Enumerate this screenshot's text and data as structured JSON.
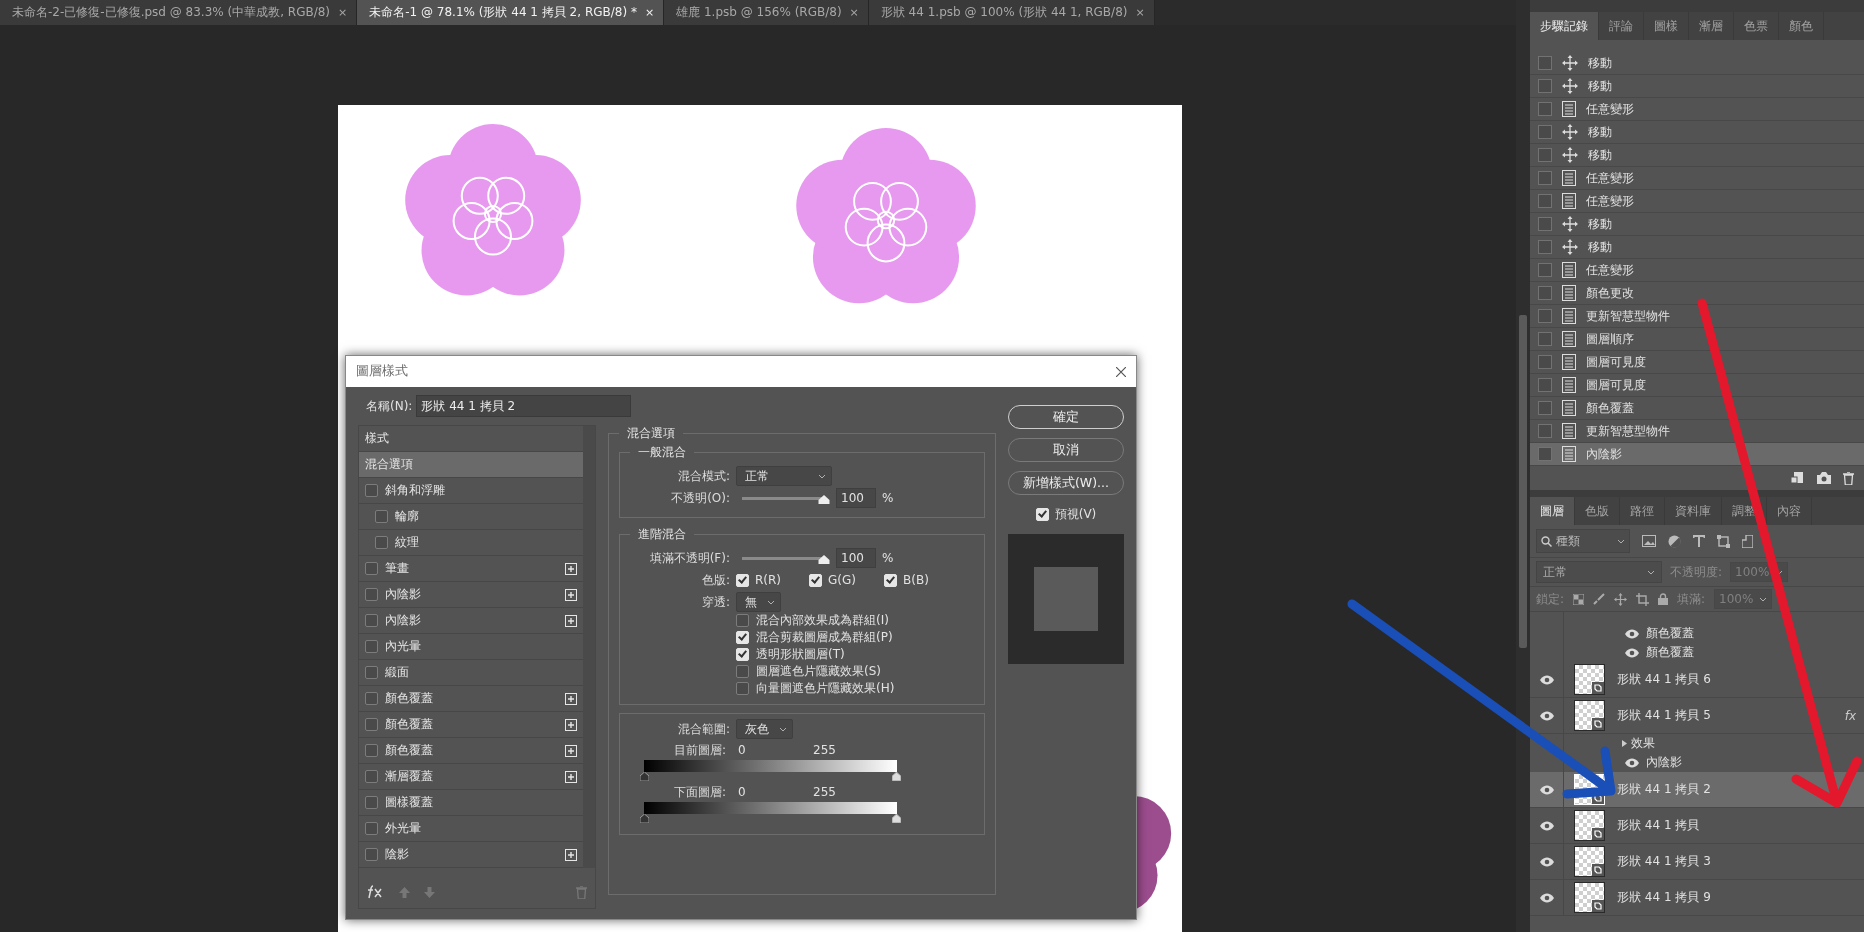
{
  "document_tabs": [
    {
      "label": "未命名-2-已修復-已修復.psd @ 83.3% (中華成教, RGB/8)",
      "close": "×",
      "selected": false
    },
    {
      "label": "未命名-1 @ 78.1% (形狀 44 1 拷貝 2, RGB/8) *",
      "close": "×",
      "selected": true
    },
    {
      "label": "雄鹿 1.psb @ 156% (RGB/8)",
      "close": "×",
      "selected": false
    },
    {
      "label": "形狀 44 1.psb @ 100% (形狀 44 1, RGB/8)",
      "close": "×",
      "selected": false
    }
  ],
  "dialog": {
    "title": "圖層樣式",
    "name_label": "名稱(N):",
    "name_value": "形狀 44 1 拷貝 2",
    "styles": [
      {
        "kind": "heading",
        "label": "樣式",
        "selected": false
      },
      {
        "kind": "option",
        "label": "混合選項",
        "selected": true
      },
      {
        "kind": "effect",
        "label": "斜角和浮雕",
        "checked": false,
        "addable": false,
        "selected": false,
        "children": [
          {
            "kind": "effect",
            "label": "輪廓",
            "checked": false,
            "addable": false,
            "selected": false
          },
          {
            "kind": "effect",
            "label": "紋理",
            "checked": false,
            "addable": false,
            "selected": false
          }
        ]
      },
      {
        "kind": "effect",
        "label": "筆畫",
        "checked": false,
        "addable": true,
        "selected": false
      },
      {
        "kind": "effect",
        "label": "內陰影",
        "checked": false,
        "addable": true,
        "selected": false
      },
      {
        "kind": "effect",
        "label": "內陰影",
        "checked": false,
        "addable": true,
        "selected": false
      },
      {
        "kind": "effect",
        "label": "內光暈",
        "checked": false,
        "addable": false,
        "selected": false
      },
      {
        "kind": "effect",
        "label": "緞面",
        "checked": false,
        "addable": false,
        "selected": false
      },
      {
        "kind": "effect",
        "label": "顏色覆蓋",
        "checked": false,
        "addable": true,
        "selected": false
      },
      {
        "kind": "effect",
        "label": "顏色覆蓋",
        "checked": false,
        "addable": true,
        "selected": false
      },
      {
        "kind": "effect",
        "label": "顏色覆蓋",
        "checked": false,
        "addable": true,
        "selected": false
      },
      {
        "kind": "effect",
        "label": "漸層覆蓋",
        "checked": false,
        "addable": true,
        "selected": false
      },
      {
        "kind": "effect",
        "label": "圖樣覆蓋",
        "checked": false,
        "addable": false,
        "selected": false
      },
      {
        "kind": "effect",
        "label": "外光暈",
        "checked": false,
        "addable": false,
        "selected": false
      },
      {
        "kind": "effect",
        "label": "陰影",
        "checked": false,
        "addable": true,
        "selected": false
      }
    ],
    "blend": {
      "title": "混合選項",
      "general": {
        "title": "一般混合",
        "mode_label": "混合模式:",
        "mode": "正常",
        "opacity": {
          "label": "不透明(O):",
          "level": 1,
          "value": "100",
          "unit": "%"
        }
      },
      "advanced": {
        "title": "進階混合",
        "fill": {
          "label": "填滿不透明(F):",
          "level": 1,
          "value": "100",
          "unit": "%"
        },
        "channels_label": "色版:",
        "channels": [
          {
            "label": "R(R)",
            "checked": true
          },
          {
            "label": "G(G)",
            "checked": true
          },
          {
            "label": "B(B)",
            "checked": true
          }
        ],
        "knockout_label": "穿透:",
        "knockout": "無",
        "options": [
          {
            "label": "混合內部效果成為群組(I)",
            "checked": false
          },
          {
            "label": "混合剪裁圖層成為群組(P)",
            "checked": true
          },
          {
            "label": "透明形狀圖層(T)",
            "checked": true
          },
          {
            "label": "圖層遮色片隱藏效果(S)",
            "checked": false
          },
          {
            "label": "向量圖遮色片隱藏效果(H)",
            "checked": false
          }
        ]
      },
      "range": {
        "label": "混合範圍:",
        "value": "灰色",
        "bars": [
          {
            "label": "目前圖層:",
            "low": "0",
            "high": "255"
          },
          {
            "label": "下面圖層:",
            "low": "0",
            "high": "255"
          }
        ]
      }
    },
    "buttons": [
      {
        "label": "確定",
        "default": true
      },
      {
        "label": "取消",
        "default": false
      },
      {
        "label": "新增樣式(W)...",
        "default": false
      }
    ],
    "preview": {
      "label": "預視(V)",
      "checked": true
    }
  },
  "history": {
    "tabs": [
      {
        "label": "步驟記錄",
        "selected": true
      },
      {
        "label": "評論",
        "selected": false
      },
      {
        "label": "圖樣",
        "selected": false
      },
      {
        "label": "漸層",
        "selected": false
      },
      {
        "label": "色票",
        "selected": false
      },
      {
        "label": "顏色",
        "selected": false
      }
    ],
    "items": [
      {
        "kind": "move",
        "label": "移動",
        "selected": false
      },
      {
        "kind": "move",
        "label": "移動",
        "selected": false
      },
      {
        "kind": "step",
        "label": "任意變形",
        "selected": false
      },
      {
        "kind": "move",
        "label": "移動",
        "selected": false
      },
      {
        "kind": "move",
        "label": "移動",
        "selected": false
      },
      {
        "kind": "step",
        "label": "任意變形",
        "selected": false
      },
      {
        "kind": "step",
        "label": "任意變形",
        "selected": false
      },
      {
        "kind": "move",
        "label": "移動",
        "selected": false
      },
      {
        "kind": "move",
        "label": "移動",
        "selected": false
      },
      {
        "kind": "step",
        "label": "任意變形",
        "selected": false
      },
      {
        "kind": "step",
        "label": "顏色更改",
        "selected": false
      },
      {
        "kind": "step",
        "label": "更新智慧型物件",
        "selected": false
      },
      {
        "kind": "step",
        "label": "圖層順序",
        "selected": false
      },
      {
        "kind": "step",
        "label": "圖層可見度",
        "selected": false
      },
      {
        "kind": "step",
        "label": "圖層可見度",
        "selected": false
      },
      {
        "kind": "step",
        "label": "顏色覆蓋",
        "selected": false
      },
      {
        "kind": "step",
        "label": "更新智慧型物件",
        "selected": false
      },
      {
        "kind": "step",
        "label": "內陰影",
        "selected": true
      }
    ]
  },
  "layers": {
    "tabs": [
      {
        "label": "圖層",
        "selected": true
      },
      {
        "label": "色版",
        "selected": false
      },
      {
        "label": "路徑",
        "selected": false
      },
      {
        "label": "資料庫",
        "selected": false
      },
      {
        "label": "調整",
        "selected": false
      },
      {
        "label": "內容",
        "selected": false
      }
    ],
    "filter": "種類",
    "blend_mode": "正常",
    "opacity_label": "不透明度:",
    "opacity_value": "100%",
    "lock_label": "鎖定:",
    "fill_label": "填滿:",
    "fill_value": "100%",
    "items": [
      {
        "kind": "effect",
        "label": "顏色覆蓋",
        "visible": true
      },
      {
        "kind": "effect",
        "label": "顏色覆蓋",
        "visible": true
      },
      {
        "kind": "layer",
        "label": "形狀 44 1 拷貝 6",
        "visible": true,
        "selected": false
      },
      {
        "kind": "layer",
        "label": "形狀 44 1 拷貝 5",
        "visible": true,
        "selected": false,
        "fx": "fx",
        "children": [
          {
            "kind": "group",
            "label": "效果",
            "children": [
              {
                "kind": "effect",
                "label": "內陰影",
                "visible": true
              }
            ]
          }
        ]
      },
      {
        "kind": "layer",
        "label": "形狀 44 1 拷貝 2",
        "visible": true,
        "selected": true
      },
      {
        "kind": "layer",
        "label": "形狀 44 1 拷貝",
        "visible": true,
        "selected": false
      },
      {
        "kind": "layer",
        "label": "形狀 44 1 拷貝 3",
        "visible": true,
        "selected": false
      },
      {
        "kind": "layer",
        "label": "形狀 44 1 拷貝 9",
        "visible": true,
        "selected": false
      }
    ]
  }
}
